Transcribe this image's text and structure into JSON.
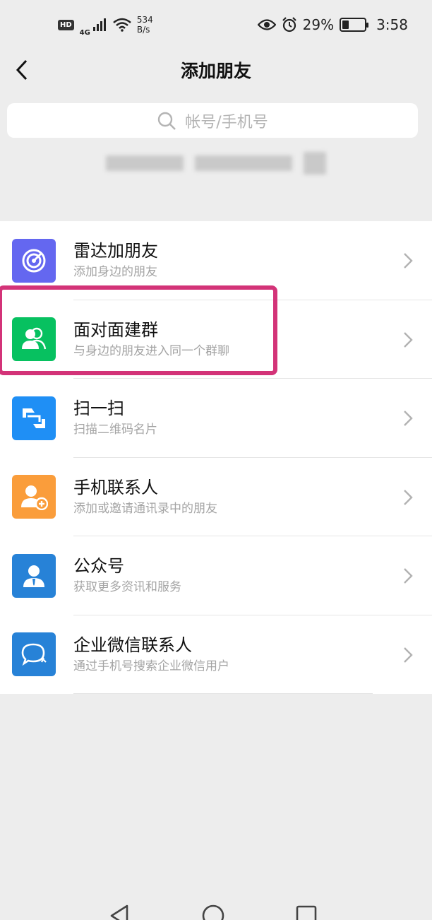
{
  "status_bar": {
    "hd": "HD",
    "network": "4G",
    "speed_value": "534",
    "speed_unit": "B/s",
    "battery": "29%",
    "time": "3:58"
  },
  "header": {
    "title": "添加朋友",
    "back_icon": "chevron-left-icon"
  },
  "search": {
    "placeholder": "帐号/手机号",
    "icon": "search-icon"
  },
  "items": [
    {
      "title": "雷达加朋友",
      "subtitle": "添加身边的朋友",
      "icon": "radar-icon",
      "color": "#6467f0"
    },
    {
      "title": "面对面建群",
      "subtitle": "与身边的朋友进入同一个群聊",
      "icon": "face-to-face-group-icon",
      "color": "#07c160"
    },
    {
      "title": "扫一扫",
      "subtitle": "扫描二维码名片",
      "icon": "scan-icon",
      "color": "#1f8ff5"
    },
    {
      "title": "手机联系人",
      "subtitle": "添加或邀请通讯录中的朋友",
      "icon": "phone-contacts-icon",
      "color": "#fa9d3b"
    },
    {
      "title": "公众号",
      "subtitle": "获取更多资讯和服务",
      "icon": "official-account-icon",
      "color": "#2782d7"
    },
    {
      "title": "企业微信联系人",
      "subtitle": "通过手机号搜索企业微信用户",
      "icon": "work-wechat-icon",
      "color": "#2782d7"
    }
  ],
  "colors": {
    "highlight": "#d33378",
    "background": "#ededed"
  }
}
